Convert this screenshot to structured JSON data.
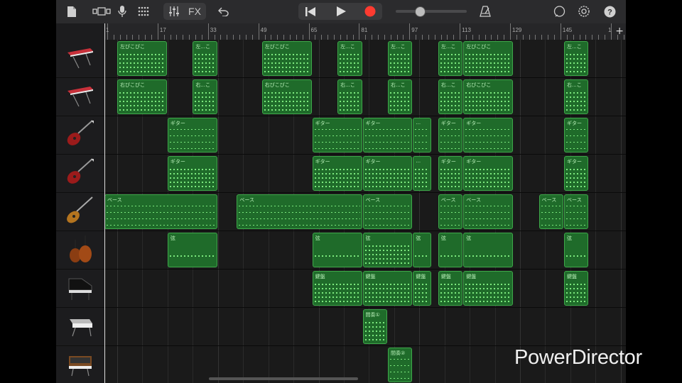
{
  "toolbar": {
    "fx_label": "FX",
    "tempo_slider_value": 0.34,
    "record_color": "#ff3b30"
  },
  "ruler": {
    "markers": [
      "1",
      "17",
      "33",
      "49",
      "65",
      "81",
      "97",
      "113",
      "129",
      "145",
      "1"
    ],
    "add_label": "+"
  },
  "tracks": [
    {
      "icon": "keyboard-synth-icon",
      "regions": [
        {
          "label": "左ぴこぴこ",
          "start": 0,
          "len": 8,
          "style": "a"
        },
        {
          "label": "左...こ",
          "start": 12,
          "len": 4,
          "style": "a"
        },
        {
          "label": "左ぴこぴこ",
          "start": 23,
          "len": 8,
          "style": "a"
        },
        {
          "label": "左...こ",
          "start": 35,
          "len": 4,
          "style": "a"
        },
        {
          "label": "左...こ",
          "start": 43,
          "len": 4,
          "style": "a"
        },
        {
          "label": "左...こ",
          "start": 51,
          "len": 4,
          "style": "a"
        },
        {
          "label": "左ぴこぴこ",
          "start": 55,
          "len": 8,
          "style": "a"
        },
        {
          "label": "左...こ",
          "start": 71,
          "len": 4,
          "style": "a"
        }
      ]
    },
    {
      "icon": "keyboard-synth-icon",
      "regions": [
        {
          "label": "右ぴこぴこ",
          "start": 0,
          "len": 8,
          "style": "a"
        },
        {
          "label": "右...こ",
          "start": 12,
          "len": 4,
          "style": "a"
        },
        {
          "label": "右ぴこぴこ",
          "start": 23,
          "len": 8,
          "style": "a"
        },
        {
          "label": "右...こ",
          "start": 35,
          "len": 4,
          "style": "a"
        },
        {
          "label": "右...こ",
          "start": 43,
          "len": 4,
          "style": "a"
        },
        {
          "label": "右...こ",
          "start": 51,
          "len": 4,
          "style": "a"
        },
        {
          "label": "右ぴこぴこ",
          "start": 55,
          "len": 8,
          "style": "a"
        },
        {
          "label": "右...こ",
          "start": 71,
          "len": 4,
          "style": "a"
        }
      ]
    },
    {
      "icon": "electric-guitar-icon",
      "regions": [
        {
          "label": "ギター",
          "start": 8,
          "len": 8,
          "style": "b"
        },
        {
          "label": "ギター",
          "start": 31,
          "len": 8,
          "style": "b"
        },
        {
          "label": "ギター",
          "start": 39,
          "len": 8,
          "style": "b"
        },
        {
          "label": "...",
          "start": 47,
          "len": 3,
          "style": "b"
        },
        {
          "label": "ギター",
          "start": 51,
          "len": 4,
          "style": "b"
        },
        {
          "label": "ギター",
          "start": 55,
          "len": 8,
          "style": "b"
        },
        {
          "label": "ギター",
          "start": 71,
          "len": 4,
          "style": "b"
        }
      ]
    },
    {
      "icon": "electric-guitar-icon",
      "regions": [
        {
          "label": "ギター",
          "start": 8,
          "len": 8,
          "style": "a"
        },
        {
          "label": "ギター",
          "start": 31,
          "len": 8,
          "style": "a"
        },
        {
          "label": "ギター",
          "start": 39,
          "len": 8,
          "style": "a"
        },
        {
          "label": "...",
          "start": 47,
          "len": 3,
          "style": "a"
        },
        {
          "label": "ギター",
          "start": 51,
          "len": 4,
          "style": "a"
        },
        {
          "label": "ギター",
          "start": 55,
          "len": 8,
          "style": "a"
        },
        {
          "label": "ギター",
          "start": 71,
          "len": 4,
          "style": "a"
        }
      ]
    },
    {
      "icon": "bass-guitar-icon",
      "regions": [
        {
          "label": "ベース",
          "start": -4,
          "len": 20,
          "style": "b"
        },
        {
          "label": "ベース",
          "start": 19,
          "len": 20,
          "style": "b"
        },
        {
          "label": "ベース",
          "start": 39,
          "len": 8,
          "style": "b"
        },
        {
          "label": "ベース",
          "start": 51,
          "len": 4,
          "style": "b"
        },
        {
          "label": "ベース",
          "start": 55,
          "len": 8,
          "style": "b"
        },
        {
          "label": "ベース",
          "start": 67,
          "len": 4,
          "style": "b"
        },
        {
          "label": "ベース",
          "start": 71,
          "len": 4,
          "style": "b"
        }
      ]
    },
    {
      "icon": "strings-icon",
      "regions": [
        {
          "label": "弦",
          "start": 8,
          "len": 8,
          "style": "c"
        },
        {
          "label": "弦",
          "start": 31,
          "len": 8,
          "style": "c"
        },
        {
          "label": "弦",
          "start": 39,
          "len": 8,
          "style": "a"
        },
        {
          "label": "弦",
          "start": 47,
          "len": 3,
          "style": "c"
        },
        {
          "label": "弦",
          "start": 51,
          "len": 4,
          "style": "c"
        },
        {
          "label": "弦",
          "start": 55,
          "len": 8,
          "style": "c"
        },
        {
          "label": "弦",
          "start": 71,
          "len": 4,
          "style": "c"
        }
      ]
    },
    {
      "icon": "grand-piano-icon",
      "regions": [
        {
          "label": "鍵盤",
          "start": 31,
          "len": 8,
          "style": "a"
        },
        {
          "label": "鍵盤",
          "start": 39,
          "len": 8,
          "style": "a"
        },
        {
          "label": "鍵盤",
          "start": 47,
          "len": 3,
          "style": "a"
        },
        {
          "label": "鍵盤",
          "start": 51,
          "len": 4,
          "style": "a"
        },
        {
          "label": "鍵盤",
          "start": 55,
          "len": 8,
          "style": "a"
        },
        {
          "label": "鍵盤",
          "start": 71,
          "len": 4,
          "style": "a"
        }
      ]
    },
    {
      "icon": "synth-module-icon",
      "regions": [
        {
          "label": "間奏①",
          "start": 39,
          "len": 4,
          "style": "a"
        }
      ]
    },
    {
      "icon": "analog-synth-icon",
      "regions": [
        {
          "label": "間奏②",
          "start": 43,
          "len": 4,
          "style": "b"
        }
      ]
    }
  ],
  "watermark": "PowerDirector"
}
